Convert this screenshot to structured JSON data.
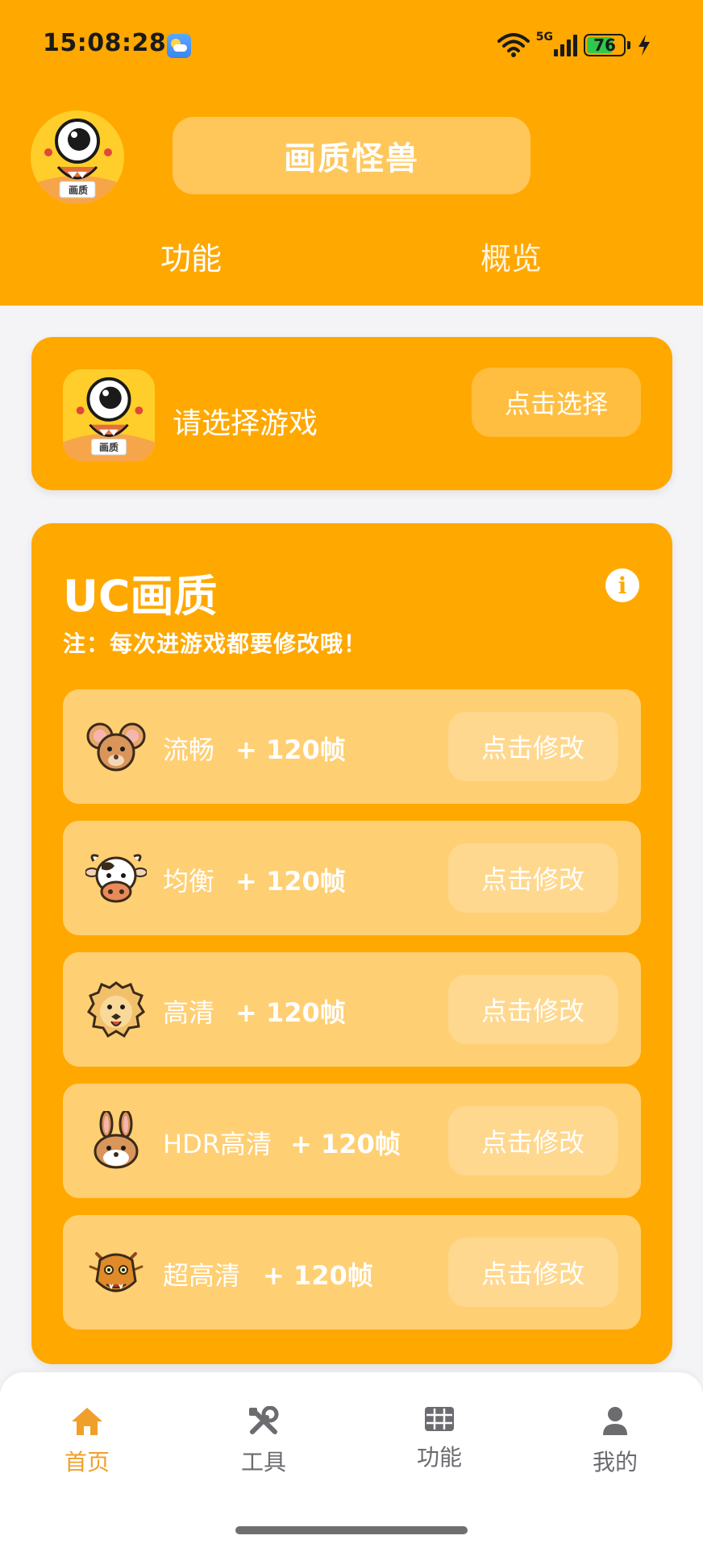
{
  "status_bar": {
    "time": "15:08:28",
    "network": "5G",
    "battery": "76",
    "battery_level": 0.76,
    "icons": [
      "weather-icon",
      "wifi-icon",
      "signal-icon",
      "battery-icon",
      "charging-bolt-icon"
    ]
  },
  "header": {
    "app_title": "画质怪兽",
    "avatar_badge": "画质",
    "tabs": [
      {
        "label": "功能"
      },
      {
        "label": "概览"
      }
    ]
  },
  "game_select": {
    "prompt": "请选择游戏",
    "button_label": "点击选择",
    "icon_badge": "画质"
  },
  "uc_card": {
    "title": "UC画质",
    "note": "注：每次进游戏都要修改哦！",
    "options": [
      {
        "name": "流畅",
        "fps": "+ 120帧",
        "button": "点击修改",
        "icon": "mouse-icon"
      },
      {
        "name": "均衡",
        "fps": "+ 120帧",
        "button": "点击修改",
        "icon": "cow-icon"
      },
      {
        "name": "高清",
        "fps": "+ 120帧",
        "button": "点击修改",
        "icon": "tiger-icon"
      },
      {
        "name": "HDR高清",
        "fps": "+ 120帧",
        "button": "点击修改",
        "icon": "rabbit-icon"
      },
      {
        "name": "超高清",
        "fps": "+ 120帧",
        "button": "点击修改",
        "icon": "dragon-icon"
      }
    ]
  },
  "bottom_nav": {
    "items": [
      {
        "label": "首页",
        "icon": "home-icon",
        "active": true
      },
      {
        "label": "工具",
        "icon": "tools-icon",
        "active": false
      },
      {
        "label": "功能",
        "icon": "grid-icon",
        "active": false
      },
      {
        "label": "我的",
        "icon": "person-icon",
        "active": false
      }
    ]
  },
  "colors": {
    "brand": "#ffa800",
    "active_nav": "#f0a02a",
    "inactive_nav": "#6b6b70"
  }
}
